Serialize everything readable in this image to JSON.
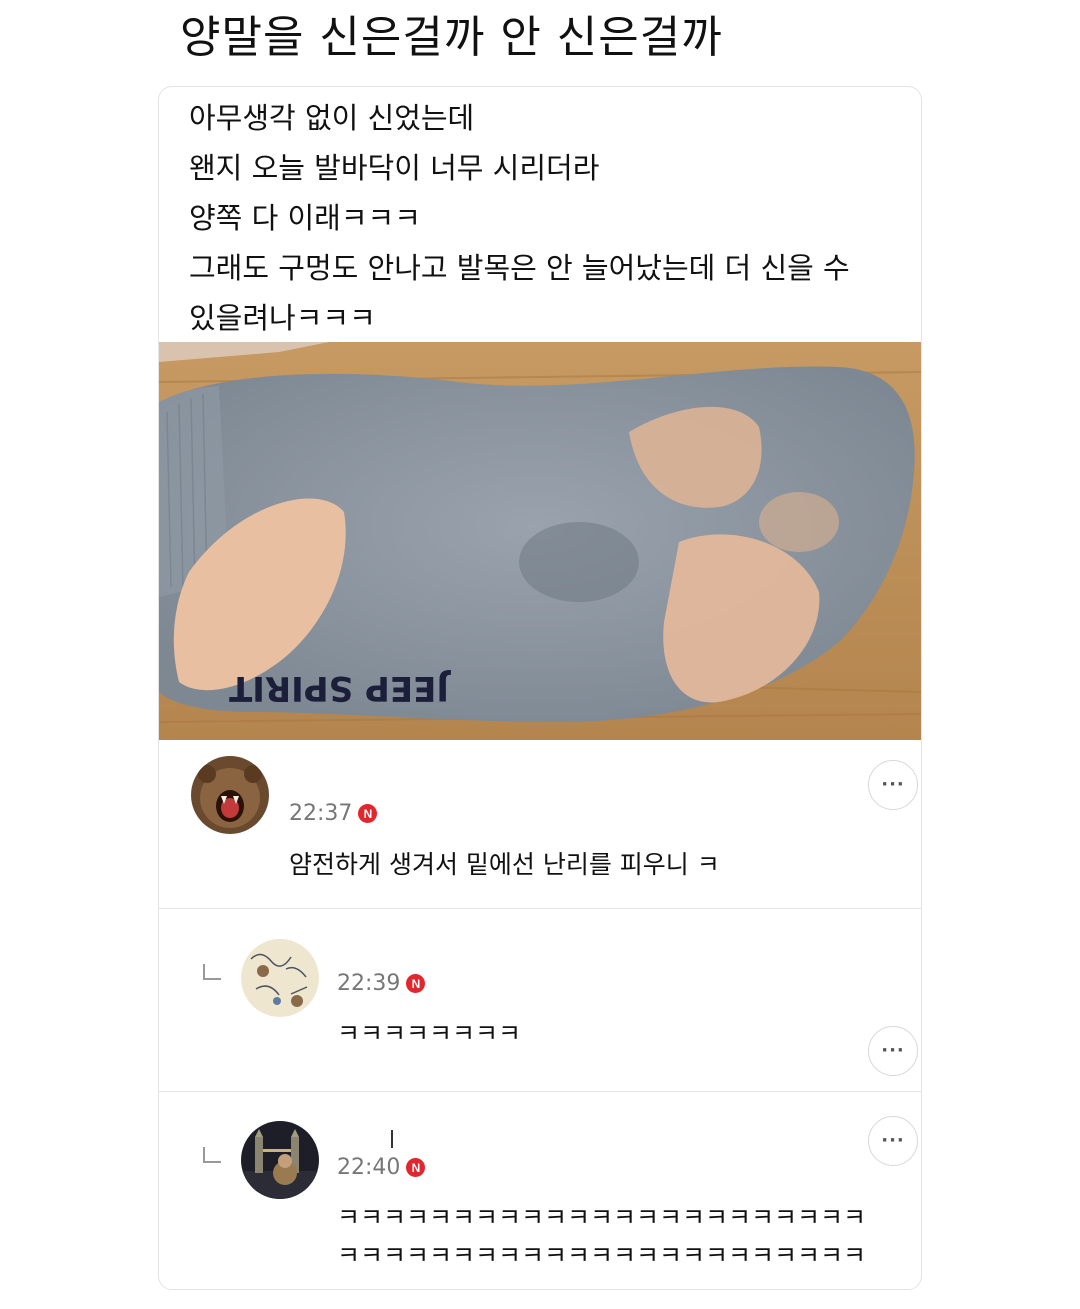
{
  "headline": "양말을 신은걸까 안 신은걸까",
  "post": {
    "lines": [
      "아무생각 없이 신었는데",
      "왠지 오늘 발바닥이 너무 시리더라",
      "양쪽 다 이래ㅋㅋㅋ",
      "그래도 구멍도 안나고 발목은 안 늘어났는데 더 신을 수",
      "있을려나ㅋㅋㅋ"
    ],
    "photo_print_text": "JEEP SPIRIT"
  },
  "comments": [
    {
      "time": "22:37",
      "badge": "N",
      "text": "얌전하게 생겨서 밑에선 난리를 피우니 ㅋ",
      "avatar_icon": "bear-avatar",
      "more_label": "···"
    },
    {
      "time": "22:39",
      "badge": "N",
      "text": "ㅋㅋㅋㅋㅋㅋㅋㅋ",
      "avatar_icon": "sketch-avatar",
      "more_label": "···"
    },
    {
      "time": "22:40",
      "badge": "N",
      "text_line1": "ㅋㅋㅋㅋㅋㅋㅋㅋㅋㅋㅋㅋㅋㅋㅋㅋㅋㅋㅋㅋㅋㅋㅋ",
      "text_line2": "ㅋㅋㅋㅋㅋㅋㅋㅋㅋㅋㅋㅋㅋㅋㅋㅋㅋㅋㅋㅋㅋㅋㅋ",
      "avatar_icon": "bridge-night-avatar",
      "more_label": "···"
    }
  ],
  "colors": {
    "badge": "#e1262d",
    "divider": "#e6e6e6",
    "time": "#777777"
  }
}
